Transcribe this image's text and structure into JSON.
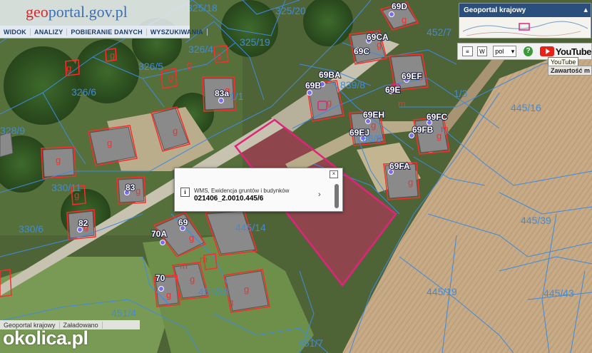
{
  "site": {
    "logo_text": "geoportal.gov.pl"
  },
  "toolbar": {
    "items": [
      "WIDOK",
      "ANALIZY",
      "POBIERANIE DANYCH",
      "WYSZUKIWANIA"
    ]
  },
  "overview": {
    "title": "Geoportal krajowy"
  },
  "tools": {
    "language": "pol",
    "youtube_label": "YouTube",
    "youtube_tooltip": "YouTube",
    "content_label": "Zawartość m"
  },
  "parcel_labels": [
    "325/18",
    "325/20",
    "325/19",
    "326/5",
    "326/4",
    "326/6",
    "328/9",
    "330/11",
    "330/6",
    "445/16",
    "445/39",
    "445/19",
    "445/43",
    "445/14",
    "451/33",
    "451/4",
    "451/7",
    "452/7",
    "839/8",
    "1/1",
    "1/3",
    "86/9",
    "8/7"
  ],
  "building_labels": [
    "69D",
    "69CA",
    "69C",
    "69BA",
    "69B",
    "69EF",
    "69E",
    "69EH",
    "69EJ",
    "69FC",
    "69FB",
    "69FA",
    "83a",
    "83",
    "82",
    "70A",
    "69",
    "70"
  ],
  "popup": {
    "layer": "WMS, Ewidencja gruntów i budynków",
    "parcel_id": "021406_2.0010.445/6"
  },
  "status": {
    "map_name": "Geoportal krajowy",
    "state": "Załadowano"
  },
  "watermark": "okolica.pl",
  "colors": {
    "parcel_line": "#3d8be0",
    "building_line": "#ff2a2a",
    "selection": "#e0247a",
    "toolbar_text": "#1c3f6a"
  }
}
